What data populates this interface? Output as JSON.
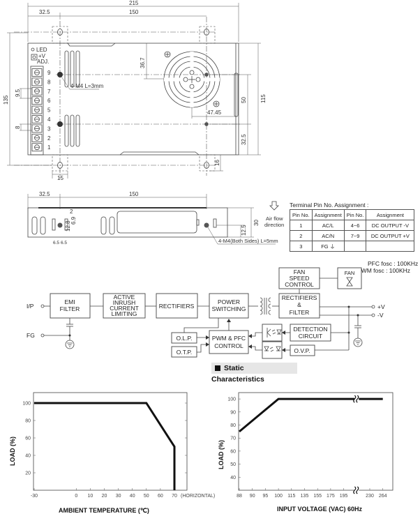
{
  "top_view": {
    "dims": {
      "overall_length": "215",
      "left_offset": "32.5",
      "hole_spacing": "150",
      "overall_width": "135",
      "body_width": "115",
      "hole_vertical": "50",
      "bottom_offset": "32.5",
      "fan_offset_v": "36.7",
      "fan_offset_h": "47.45",
      "tab_height": "16",
      "tab_width": "15",
      "terminal_pitch": "9.5",
      "terminal_gap": "8"
    },
    "led_label": "LED",
    "adj_label_1": "+V",
    "adj_label_2": "ADJ.",
    "pins": [
      "9",
      "8",
      "7",
      "6",
      "5",
      "4",
      "3",
      "2",
      "1"
    ],
    "screw_note": "4-M4 L=3mm"
  },
  "side_view": {
    "dims": {
      "left_offset": "32.5",
      "hole_spacing": "150",
      "slot_width": "2",
      "slot_height": "6.9",
      "hole_height": "12.8",
      "pitch_a": "6.5",
      "pitch_b": "6.5",
      "screw_height": "12.5",
      "height": "30"
    },
    "screw_note": "4-M4(Both Sides) L=5mm",
    "airflow_icon": "down-arrow-icon",
    "airflow_line1": "Air flow",
    "airflow_line2": "direction"
  },
  "pin_table": {
    "title": "Terminal Pin No. Assignment :",
    "headers": [
      "Pin No.",
      "Assignment",
      "Pin No.",
      "Assignment"
    ],
    "rows": [
      [
        "1",
        "AC/L",
        "4~6",
        "DC OUTPUT -V"
      ],
      [
        "2",
        "AC/N",
        "7~9",
        "DC OUTPUT +V"
      ],
      [
        "3",
        "FG ⏚",
        "",
        ""
      ]
    ]
  },
  "block_diagram": {
    "freq_pfc": "PFC fosc : 100KHz",
    "freq_pwm": "PWM fosc : 100KHz",
    "input_label": "I/P",
    "fg_label": "FG",
    "out_pos": "+V",
    "out_neg": "-V",
    "emi": [
      "EMI",
      "FILTER"
    ],
    "inrush": [
      "ACTIVE",
      "INRUSH",
      "CURRENT",
      "LIMITING"
    ],
    "rectifiers": "RECTIFIERS",
    "power_switching": [
      "POWER",
      "SWITCHING"
    ],
    "rect_filter": [
      "RECTIFIERS",
      "&",
      "FILTER"
    ],
    "fan_speed": [
      "FAN",
      "SPEED",
      "CONTROL"
    ],
    "fan": "FAN",
    "olp": "O.L.P.",
    "otp": "O.T.P.",
    "pwm_pfc": [
      "PWM & PFC",
      "CONTROL"
    ],
    "detection": [
      "DETECTION",
      "CIRCUIT"
    ],
    "ovp": "O.V.P."
  },
  "section_title": "Static Characteristics",
  "chart_data": [
    {
      "type": "line",
      "title": "",
      "xlabel": "AMBIENT TEMPERATURE (℃)",
      "ylabel": "LOAD (%)",
      "x_note": "(HORIZONTAL)",
      "x_ticks": [
        "-30",
        "0",
        "10",
        "20",
        "30",
        "40",
        "50",
        "60",
        "70"
      ],
      "y_ticks": [
        "20",
        "40",
        "60",
        "80",
        "100"
      ],
      "xlim": [
        -30,
        79
      ],
      "ylim": [
        0,
        112
      ],
      "grid": false,
      "series": [
        {
          "x": [
            -30,
            50,
            70,
            70
          ],
          "y": [
            100,
            100,
            50,
            0
          ]
        }
      ],
      "line_color": "#111111"
    },
    {
      "type": "line",
      "title": "",
      "xlabel": "INPUT VOLTAGE (VAC) 60Hz",
      "ylabel": "LOAD (%)",
      "x_ticks": [
        "88",
        "90",
        "95",
        "100",
        "115",
        "135",
        "155",
        "175",
        "195",
        "230",
        "264"
      ],
      "x_axis_break_between": [
        "195",
        "230"
      ],
      "y_ticks": [
        "40",
        "50",
        "60",
        "70",
        "80",
        "90",
        "100"
      ],
      "ylim": [
        30,
        105
      ],
      "grid": false,
      "series": [
        {
          "x": [
            88,
            100,
            264
          ],
          "y": [
            75,
            100,
            100
          ]
        }
      ],
      "line_color": "#111111"
    }
  ]
}
